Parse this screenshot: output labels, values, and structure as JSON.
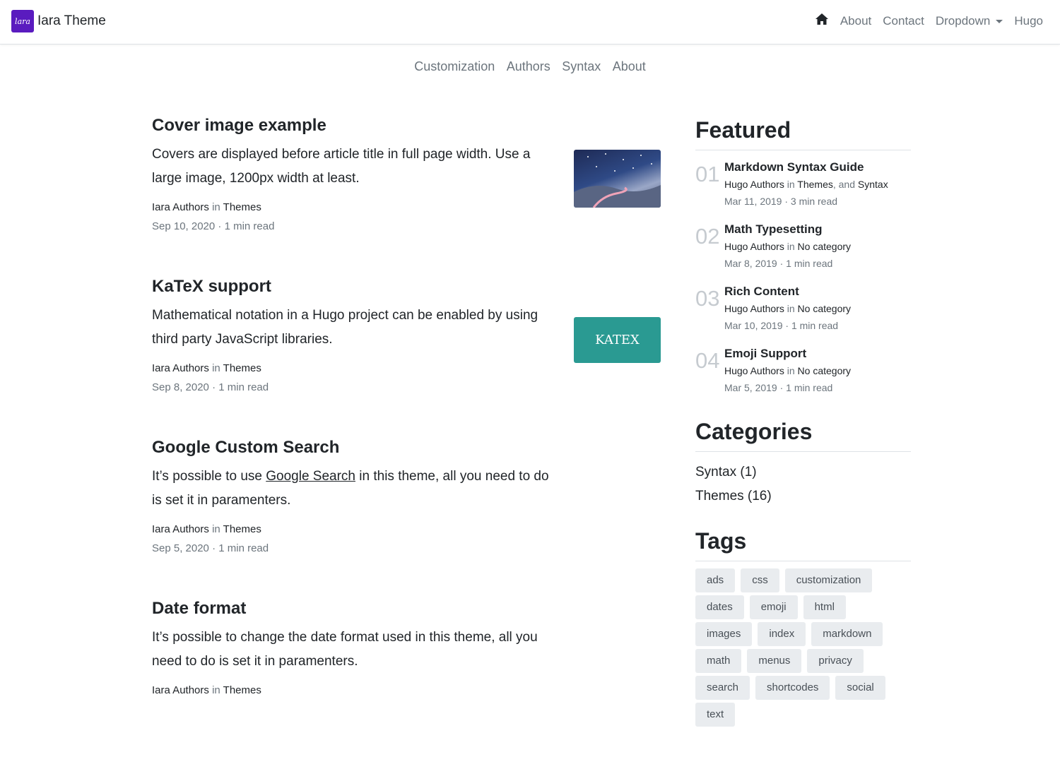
{
  "brand": {
    "logo_text": "lara",
    "name": "Iara Theme"
  },
  "topnav": {
    "about": "About",
    "contact": "Contact",
    "dropdown": "Dropdown",
    "hugo": "Hugo"
  },
  "subnav": [
    "Customization",
    "Authors",
    "Syntax",
    "About"
  ],
  "posts": [
    {
      "title": "Cover image example",
      "excerpt": "Covers are displayed before article title in full page width. Use a large image, 1200px width at least.",
      "author": "Iara Authors",
      "in": "in",
      "category": "Themes",
      "date": "Sep 10, 2020 · 1 min read"
    },
    {
      "title": "KaTeX support",
      "excerpt": "Mathematical notation in a Hugo project can be enabled by using third party JavaScript libraries.",
      "author": "Iara Authors",
      "in": "in",
      "category": "Themes",
      "date": "Sep 8, 2020 · 1 min read",
      "thumb_text": "KATEX"
    },
    {
      "title": "Google Custom Search",
      "excerpt_pre": "It’s possible to use ",
      "excerpt_link": "Google Search",
      "excerpt_post": " in this theme, all you need to do is set it in paramenters.",
      "author": "Iara Authors",
      "in": "in",
      "category": "Themes",
      "date": "Sep 5, 2020 · 1 min read"
    },
    {
      "title": "Date format",
      "excerpt": "It’s possible to change the date format used in this theme, all you need to do is set it in paramenters.",
      "author": "Iara Authors",
      "in": "in",
      "category": "Themes"
    }
  ],
  "featured": {
    "heading": "Featured",
    "items": [
      {
        "num": "01",
        "title": "Markdown Syntax Guide",
        "author": "Hugo Authors",
        "in": "in",
        "cat1": "Themes",
        "and": ", and",
        "cat2": "Syntax",
        "date": "Mar 11, 2019 · 3 min read"
      },
      {
        "num": "02",
        "title": "Math Typesetting",
        "author": "Hugo Authors",
        "in": "in",
        "cat1": "No category",
        "date": "Mar 8, 2019 · 1 min read"
      },
      {
        "num": "03",
        "title": "Rich Content",
        "author": "Hugo Authors",
        "in": "in",
        "cat1": "No category",
        "date": "Mar 10, 2019 · 1 min read"
      },
      {
        "num": "04",
        "title": "Emoji Support",
        "author": "Hugo Authors",
        "in": "in",
        "cat1": "No category",
        "date": "Mar 5, 2019 · 1 min read"
      }
    ]
  },
  "categories": {
    "heading": "Categories",
    "items": [
      "Syntax (1)",
      "Themes (16)"
    ]
  },
  "tags": {
    "heading": "Tags",
    "items": [
      "ads",
      "css",
      "customization",
      "dates",
      "emoji",
      "html",
      "images",
      "index",
      "markdown",
      "math",
      "menus",
      "privacy",
      "search",
      "shortcodes",
      "social",
      "text"
    ]
  }
}
